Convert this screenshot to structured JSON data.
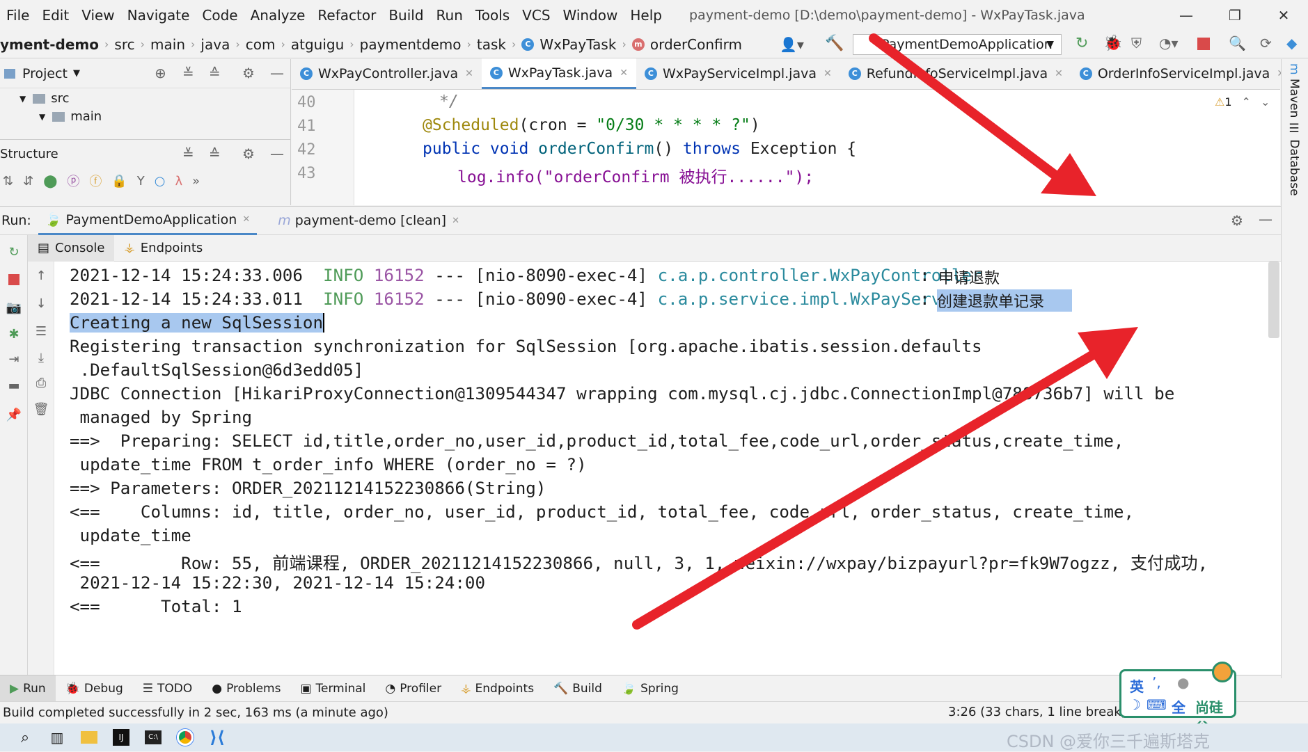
{
  "menu": {
    "items": [
      "File",
      "Edit",
      "View",
      "Navigate",
      "Code",
      "Analyze",
      "Refactor",
      "Build",
      "Run",
      "Tools",
      "VCS",
      "Window",
      "Help"
    ],
    "window_title": "payment-demo [D:\\demo\\payment-demo] - WxPayTask.java"
  },
  "nav": {
    "crumbs": [
      "yment-demo",
      "src",
      "main",
      "java",
      "com",
      "atguigu",
      "paymentdemo",
      "task",
      "WxPayTask",
      "orderConfirm"
    ],
    "run_config": "PaymentDemoApplication"
  },
  "project": {
    "header": "Project",
    "tree": [
      {
        "label": "src"
      },
      {
        "label": "main"
      }
    ],
    "structure_header": "Structure"
  },
  "editor": {
    "tabs": [
      "WxPayController.java",
      "WxPayTask.java",
      "WxPayServiceImpl.java",
      "RefundInfoServiceImpl.java",
      "OrderInfoServiceImpl.java"
    ],
    "active_tab": "WxPayTask.java",
    "warning_count": "1",
    "lines": [
      {
        "num": "40",
        "text": "*/"
      },
      {
        "num": "41",
        "anno": "@Scheduled",
        "rest": "(cron = ",
        "str": "\"0/30 * * * * ?\"",
        "end": ")"
      },
      {
        "num": "42",
        "kw1": "public void ",
        "fn": "orderConfirm",
        "mid": "() ",
        "kw2": "throws",
        "end": " Exception {"
      },
      {
        "num": "43",
        "text": "log.info(\"orderConfirm 被执行......\");"
      }
    ]
  },
  "run": {
    "label": "Run:",
    "tabs": [
      "PaymentDemoApplication",
      "payment-demo [clean]"
    ],
    "subtabs": [
      "Console",
      "Endpoints"
    ],
    "console": [
      {
        "date": "2021-12-14 15:24:33.006",
        "level": "INFO",
        "pid": "16152",
        "sep": "---",
        "thread": "[nio-8090-exec-4]",
        "logger": "c.a.p.controller.WxPayController",
        "colon": ":",
        "msg": "申请退款"
      },
      {
        "date": "2021-12-14 15:24:33.011",
        "level": "INFO",
        "pid": "16152",
        "sep": "---",
        "thread": "[nio-8090-exec-4]",
        "logger": "c.a.p.service.impl.WxPayServiceImpl",
        "colon": ":",
        "msg": "创建退款单记录"
      },
      "Creating a new SqlSession",
      "Registering transaction synchronization for SqlSession [org.apache.ibatis.session.defaults",
      " .DefaultSqlSession@6d3edd05]",
      "JDBC Connection [HikariProxyConnection@1309544347 wrapping com.mysql.cj.jdbc.ConnectionImpl@788736b7] will be",
      " managed by Spring",
      "==>  Preparing: SELECT id,title,order_no,user_id,product_id,total_fee,code_url,order_status,create_time,",
      " update_time FROM t_order_info WHERE (order_no = ?)",
      "==> Parameters: ORDER_20211214152230866(String)",
      "<==    Columns: id, title, order_no, user_id, product_id, total_fee, code_url, order_status, create_time,",
      " update_time",
      "<==        Row: 55, 前端课程, ORDER_20211214152230866, null, 3, 1, weixin://wxpay/bizpayurl?pr=fk9W7ogzz, 支付成功,",
      " 2021-12-14 15:22:30, 2021-12-14 15:24:00",
      "<==      Total: 1"
    ]
  },
  "bottom_tabs": [
    "Run",
    "Debug",
    "TODO",
    "Problems",
    "Terminal",
    "Profiler",
    "Endpoints",
    "Build",
    "Spring"
  ],
  "status": {
    "message": "Build completed successfully in 2 sec, 163 ms (a minute ago)",
    "position": "3:26 (33 chars, 1 line break)"
  },
  "side_tools": [
    "Maven",
    "Database"
  ],
  "ime": {
    "lang": "英",
    "mode": "全",
    "brand": "尚硅谷"
  },
  "watermark": "CSDN @爱你三千遍斯塔克",
  "colors": {
    "arrow": "#e8232a",
    "accent": "#4a88c7",
    "selection": "#a8c8ef"
  }
}
